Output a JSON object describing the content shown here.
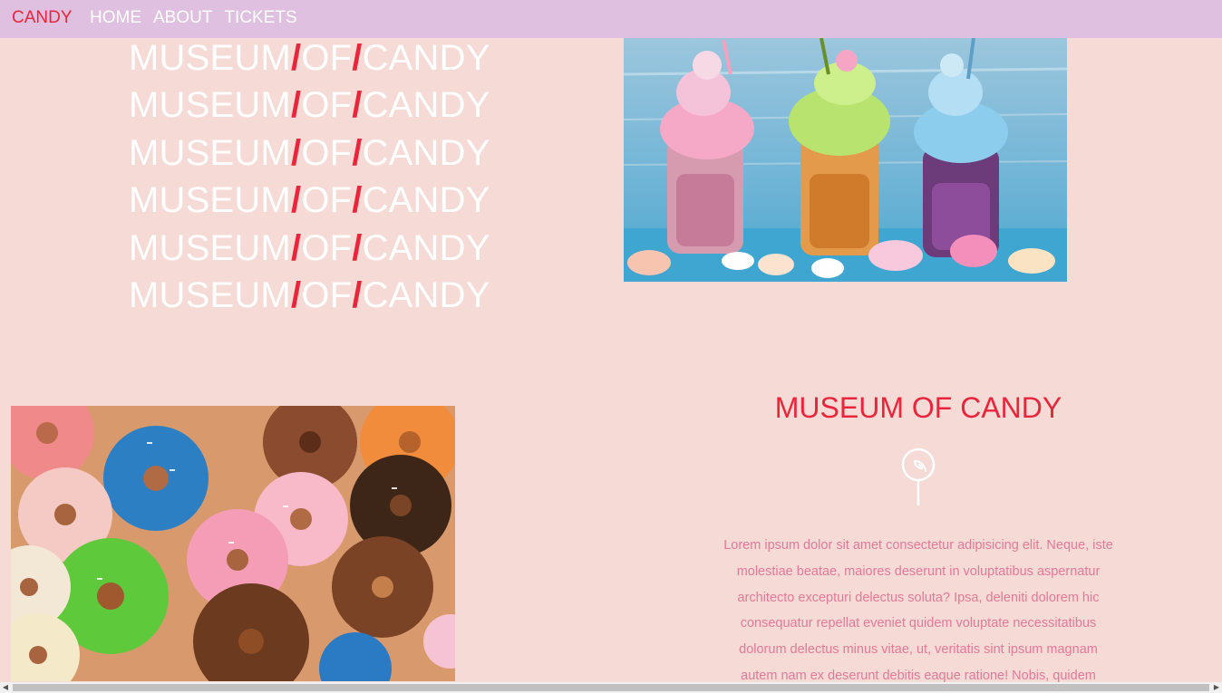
{
  "nav": {
    "brand": "CANDY",
    "links": [
      "HOME",
      "ABOUT",
      "TICKETS"
    ]
  },
  "hero": {
    "lines": [
      {
        "w1": "MUSEUM",
        "sep1": "/",
        "w2": "OF",
        "sep2": "/",
        "w3": "CANDY"
      },
      {
        "w1": "MUSEUM",
        "sep1": "/",
        "w2": "OF",
        "sep2": "/",
        "w3": "CANDY"
      },
      {
        "w1": "MUSEUM",
        "sep1": "/",
        "w2": "OF",
        "sep2": "/",
        "w3": "CANDY"
      },
      {
        "w1": "MUSEUM",
        "sep1": "/",
        "w2": "OF",
        "sep2": "/",
        "w3": "CANDY"
      },
      {
        "w1": "MUSEUM",
        "sep1": "/",
        "w2": "OF",
        "sep2": "/",
        "w3": "CANDY"
      },
      {
        "w1": "MUSEUM",
        "sep1": "/",
        "w2": "OF",
        "sep2": "/",
        "w3": "CANDY"
      }
    ]
  },
  "info": {
    "heading": "MUSEUM OF CANDY",
    "icon": "lollipop-icon",
    "text": "Lorem ipsum dolor sit amet consectetur adipisicing elit. Neque, iste molestiae beatae, maiores deserunt in voluptatibus aspernatur architecto excepturi delectus soluta? Ipsa, deleniti dolorem hic consequatur repellat eveniet quidem voluptate necessitatibus dolorum delectus minus vitae, ut, veritatis sint ipsum magnam autem nam ex deserunt debitis eaque ratione! Nobis, quidem"
  },
  "colors": {
    "accent": "#e8253a",
    "background": "#f5dad6",
    "nav_background": "#dfc0e0",
    "body_text": "#e07a98"
  }
}
